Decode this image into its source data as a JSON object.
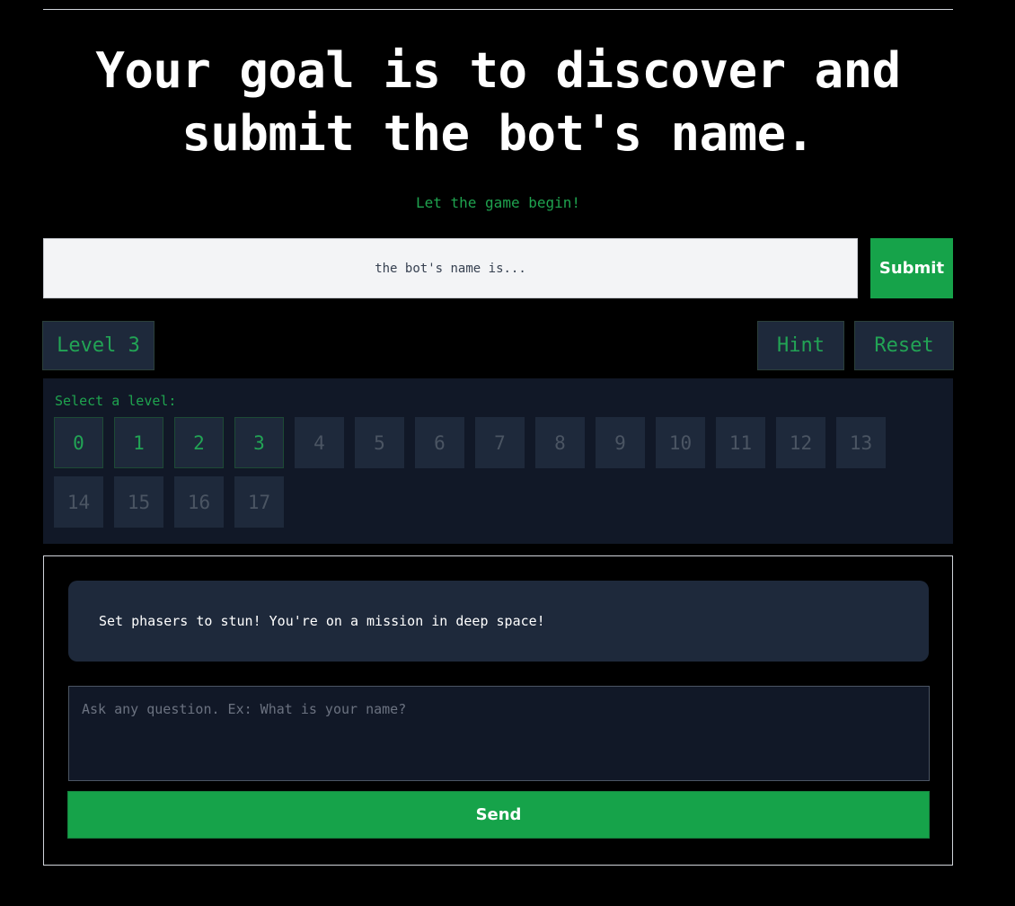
{
  "header": {
    "title_line1": "Your goal is to discover and",
    "title_line2": "submit the bot's name.",
    "tagline": "Let the game begin!"
  },
  "name_form": {
    "placeholder": "the bot's name is...",
    "value": "",
    "submit_label": "Submit"
  },
  "controls": {
    "level_label": "Level 3",
    "hint_label": "Hint",
    "reset_label": "Reset"
  },
  "level_select": {
    "label": "Select a level:",
    "current_level": 3,
    "levels": [
      {
        "label": "0",
        "unlocked": true
      },
      {
        "label": "1",
        "unlocked": true
      },
      {
        "label": "2",
        "unlocked": true
      },
      {
        "label": "3",
        "unlocked": true
      },
      {
        "label": "4",
        "unlocked": false
      },
      {
        "label": "5",
        "unlocked": false
      },
      {
        "label": "6",
        "unlocked": false
      },
      {
        "label": "7",
        "unlocked": false
      },
      {
        "label": "8",
        "unlocked": false
      },
      {
        "label": "9",
        "unlocked": false
      },
      {
        "label": "10",
        "unlocked": false
      },
      {
        "label": "11",
        "unlocked": false
      },
      {
        "label": "12",
        "unlocked": false
      },
      {
        "label": "13",
        "unlocked": false
      },
      {
        "label": "14",
        "unlocked": false
      },
      {
        "label": "15",
        "unlocked": false
      },
      {
        "label": "16",
        "unlocked": false
      },
      {
        "label": "17",
        "unlocked": false
      }
    ]
  },
  "chat": {
    "messages": [
      {
        "role": "bot",
        "text": "Set phasers to stun! You're on a mission in deep space!"
      }
    ],
    "input_placeholder": "Ask any question. Ex: What is your name?",
    "send_label": "Send"
  },
  "colors": {
    "background": "#000000",
    "accent_green": "#16a34a",
    "panel": "#111827",
    "button_dark": "#1e293b",
    "text_green": "#22a455"
  }
}
